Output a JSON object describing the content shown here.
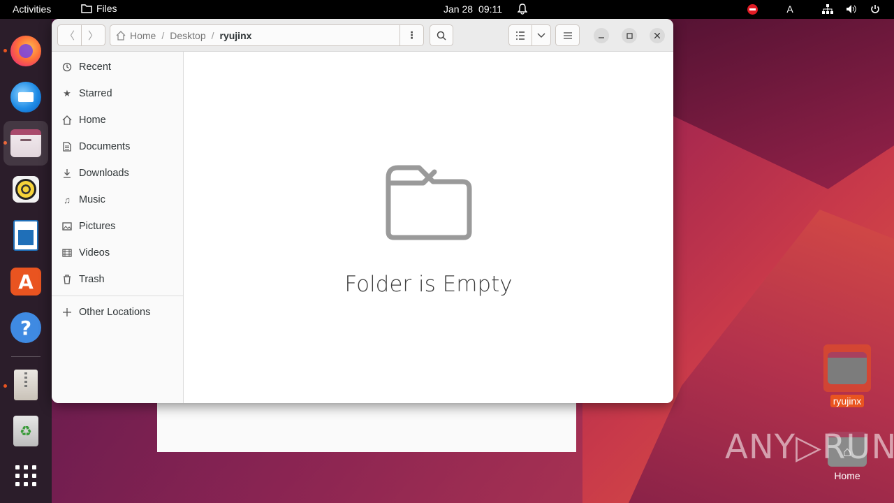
{
  "topbar": {
    "activities": "Activities",
    "app_name": "Files",
    "date": "Jan 28",
    "time": "09:11",
    "keyboard_indicator": "A"
  },
  "dock": {
    "items": [
      "firefox",
      "thunderbird",
      "files",
      "rhythmbox",
      "libreoffice-writer",
      "app-center",
      "help",
      "archive-manager",
      "trash",
      "show-apps"
    ]
  },
  "window": {
    "path": [
      "Home",
      "Desktop",
      "ryujinx"
    ],
    "sidebar": [
      {
        "label": "Recent",
        "icon": "clock-icon"
      },
      {
        "label": "Starred",
        "icon": "star-icon"
      },
      {
        "label": "Home",
        "icon": "home-icon"
      },
      {
        "label": "Documents",
        "icon": "document-icon"
      },
      {
        "label": "Downloads",
        "icon": "download-icon"
      },
      {
        "label": "Music",
        "icon": "music-icon"
      },
      {
        "label": "Pictures",
        "icon": "picture-icon"
      },
      {
        "label": "Videos",
        "icon": "video-icon"
      },
      {
        "label": "Trash",
        "icon": "trash-icon"
      }
    ],
    "other_locations": "Other Locations",
    "empty_message": "Folder is Empty"
  },
  "desktop": {
    "icons": [
      {
        "label": "ryujinx",
        "selected": true
      },
      {
        "label": "Home",
        "selected": false
      }
    ]
  },
  "watermark": "ANY▷RUN",
  "colors": {
    "accent": "#e95420",
    "topbar": "#000000",
    "dock": "#2b1d2a"
  }
}
